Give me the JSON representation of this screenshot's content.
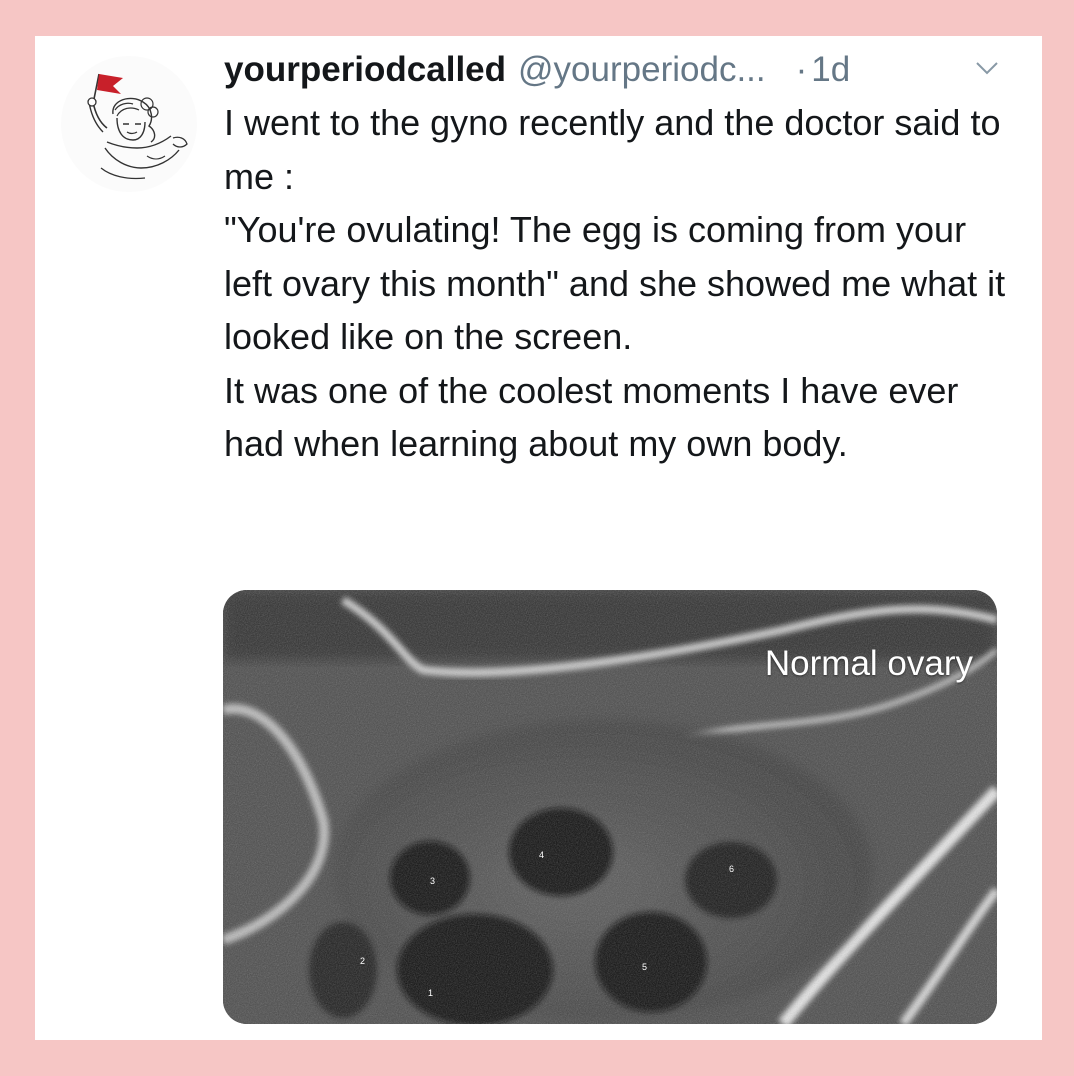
{
  "tweet": {
    "display_name": "yourperiodcalled",
    "handle": "@yourperiodc...",
    "separator": "·",
    "time": "1d",
    "paragraphs": [
      "I went to the gyno recently and the doctor said to me :",
      "\"You're ovulating! The egg is coming from your left ovary this month\" and she showed me what it looked like on the screen.",
      "It was one of the coolest moments I have ever had when learning about my own body."
    ]
  },
  "media": {
    "caption": "Normal ovary",
    "follicle_labels": [
      "1",
      "2",
      "3",
      "4",
      "5",
      "6"
    ]
  },
  "icons": {
    "menu": "chevron-down-icon",
    "avatar": "flag-girl-illustration"
  },
  "colors": {
    "frame": "#f6c6c5",
    "card": "#ffffff",
    "text": "#14171a",
    "muted": "#657786",
    "flag": "#c8202a"
  }
}
